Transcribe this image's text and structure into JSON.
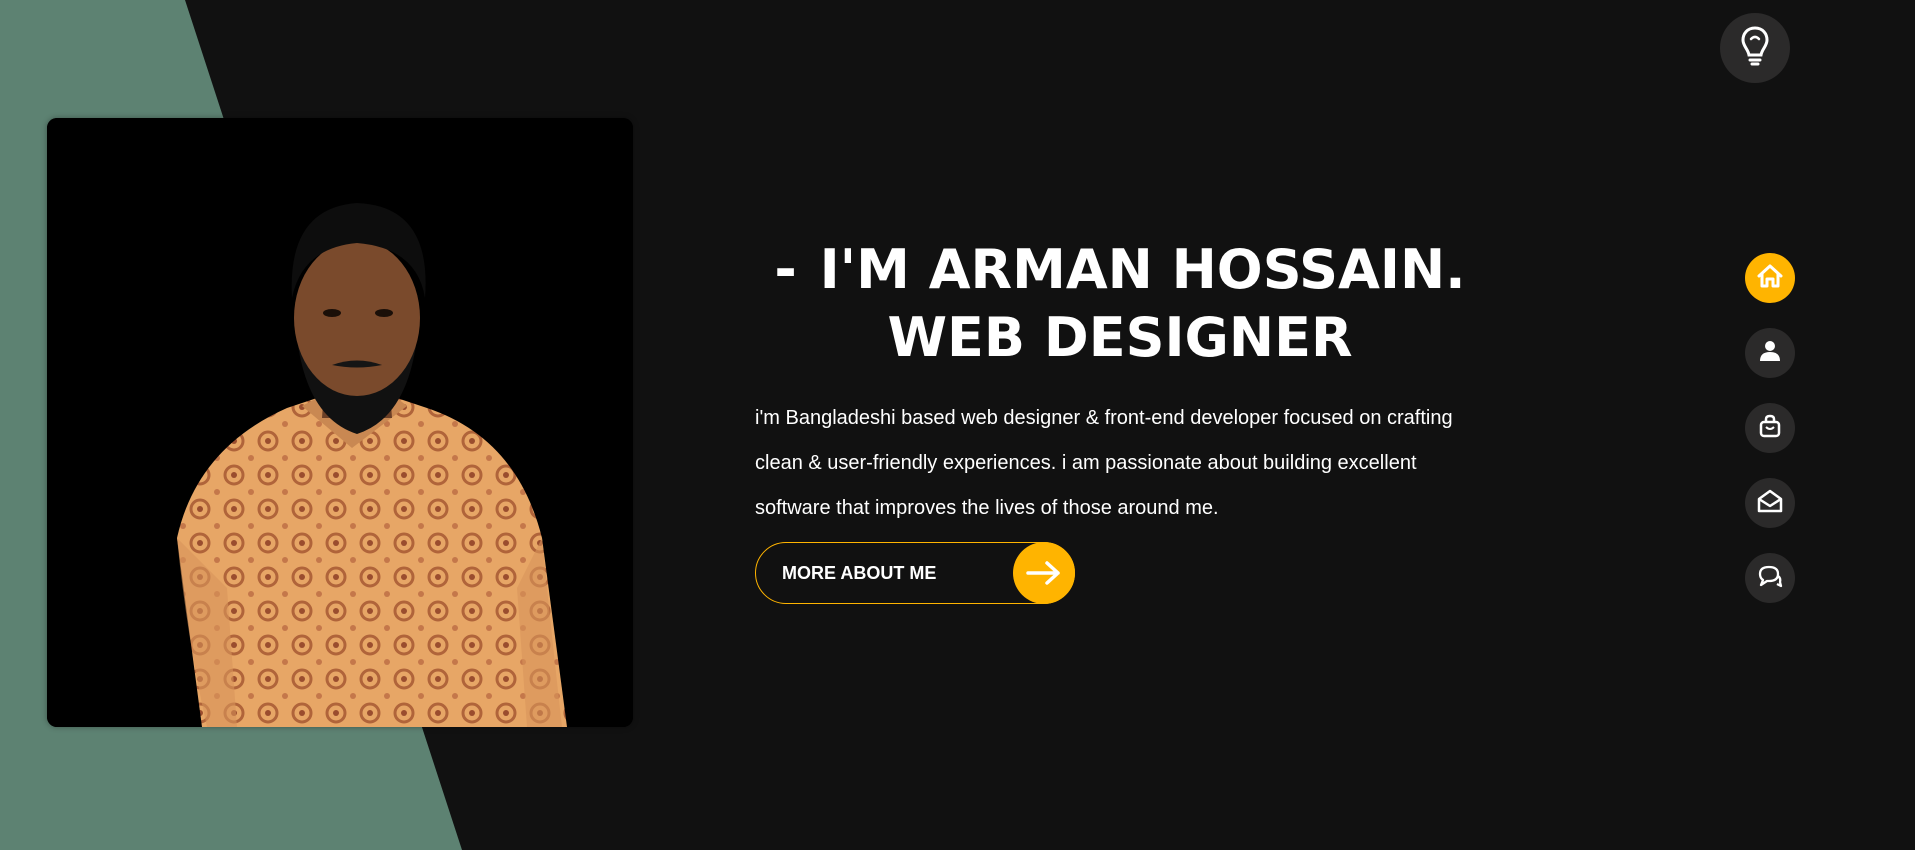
{
  "hero": {
    "title_dash": "-",
    "title_line1": "I'M ARMAN HOSSAIN.",
    "title_line2": "WEB DESIGNER",
    "bio": "i'm Bangladeshi based web designer & front-end developer focused on crafting clean & user-friendly experiences. i am passionate about building excellent software that improves the lives of those around me."
  },
  "cta": {
    "label": "MORE ABOUT ME",
    "icon": "arrow-right-icon"
  },
  "theme_toggle": {
    "icon": "lightbulb-icon"
  },
  "side_nav": {
    "items": [
      {
        "icon": "home-icon",
        "active": true
      },
      {
        "icon": "user-icon",
        "active": false
      },
      {
        "icon": "briefcase-icon",
        "active": false
      },
      {
        "icon": "envelope-open-icon",
        "active": false
      },
      {
        "icon": "chat-icon",
        "active": false
      }
    ]
  },
  "colors": {
    "background": "#111111",
    "accent": "#ffb400",
    "slant": "#5d8272",
    "nav_button": "#2b2a2a",
    "text": "#ffffff"
  }
}
